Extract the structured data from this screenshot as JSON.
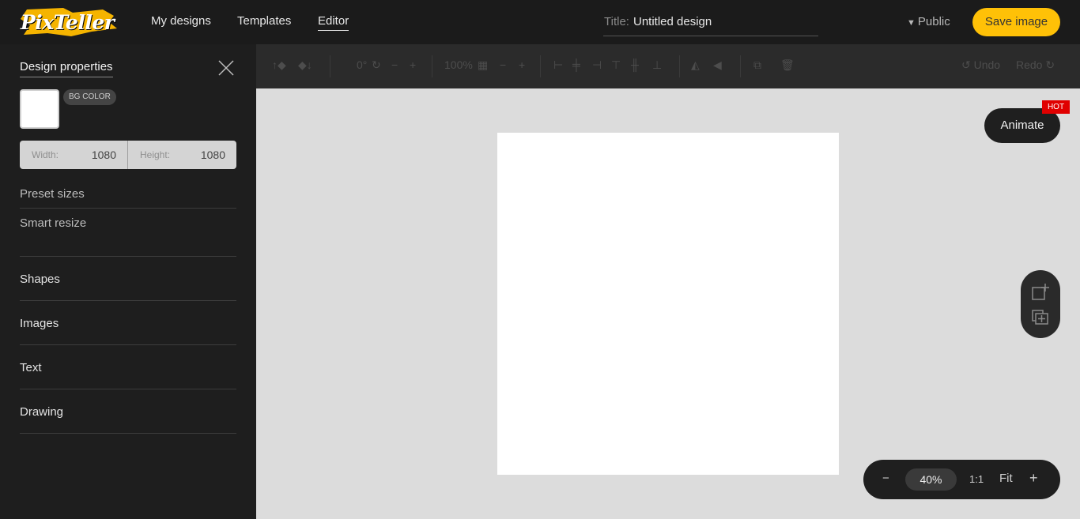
{
  "header": {
    "logo_text": "PixTeller",
    "nav": [
      "My designs",
      "Templates",
      "Editor"
    ],
    "title_label": "Title:",
    "title_value": "Untitled design",
    "visibility": "Public",
    "save_label": "Save image"
  },
  "sidebar": {
    "title": "Design properties",
    "bg_color_label": "BG COLOR",
    "bg_color": "#ffffff",
    "width_label": "Width:",
    "width_value": "1080",
    "height_label": "Height:",
    "height_value": "1080",
    "links": [
      "Preset sizes",
      "Smart resize"
    ],
    "sections": [
      "Shapes",
      "Images",
      "Text",
      "Drawing"
    ]
  },
  "toolbar": {
    "rotation": "0°",
    "opacity": "100%",
    "undo_label": "Undo",
    "redo_label": "Redo"
  },
  "workspace": {
    "animate_label": "Animate",
    "hot_label": "HOT",
    "zoom_value": "40%",
    "one_to_one_label": "1:1",
    "fit_label": "Fit"
  },
  "colors": {
    "accent": "#ffc107",
    "topbar": "#1b1b1b",
    "sidebar": "#1e1e1e",
    "workspace": "#dcdcdc",
    "hot": "#e00000"
  }
}
